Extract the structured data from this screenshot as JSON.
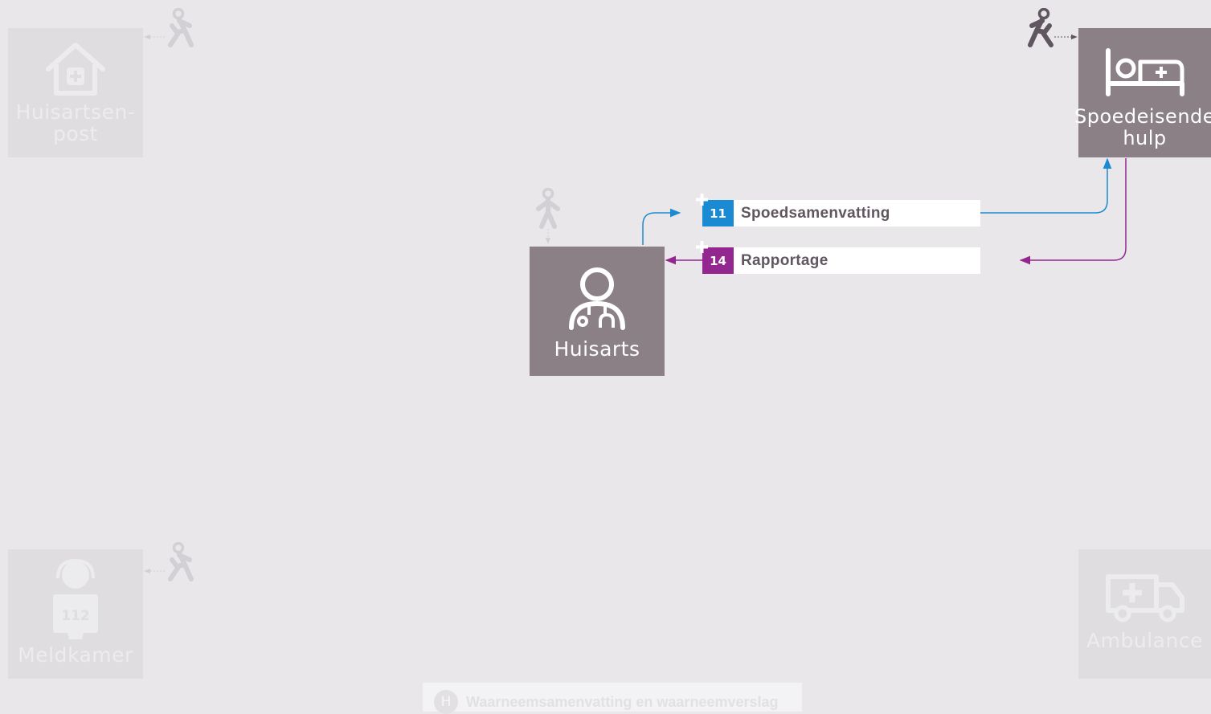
{
  "nodes": {
    "huisartsenpost": {
      "label": "Huisartsen-\npost",
      "icon": "house-plus-icon",
      "state": "faded"
    },
    "spoedeisende_hulp": {
      "label": "Spoedeisende\nhulp",
      "icon": "hospital-bed-icon",
      "state": "active"
    },
    "huisarts": {
      "label": "Huisarts",
      "icon": "doctor-icon",
      "state": "active"
    },
    "meldkamer": {
      "label": "Meldkamer",
      "icon": "dispatcher-112-icon",
      "screen_text": "112",
      "state": "faded"
    },
    "ambulance": {
      "label": "Ambulance",
      "icon": "ambulance-icon",
      "state": "faded"
    }
  },
  "messages": [
    {
      "number": "11",
      "label": "Spoedsamenvatting",
      "color": "#1a8bd2"
    },
    {
      "number": "14",
      "label": "Rapportage",
      "color": "#93278f"
    }
  ],
  "bottom_bar": {
    "badge": "H",
    "label": "Waarneemsamenvatting en waarneemverslag"
  },
  "colors": {
    "active_box": "#8c8087",
    "faded_box": "#dfdde0",
    "blue_flow": "#1a8bd2",
    "purple_flow": "#93278f",
    "walker_active": "#5f5660",
    "walker_faded": "#d2d0d4"
  }
}
